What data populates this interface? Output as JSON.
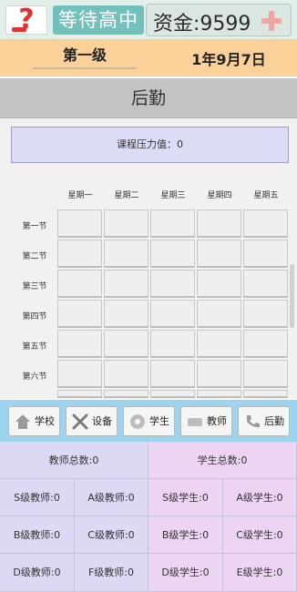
{
  "topbar": {
    "status": "等待高中",
    "funds": "资金:9599",
    "add_icon": "plus-icon",
    "avatar_icon": "question-mark-icon",
    "colors": {
      "status_pill": "#72c1bd",
      "plus": "#f2a3a3",
      "question": "#e03030"
    }
  },
  "infobar": {
    "level": "第一级",
    "date": "1年9月7日"
  },
  "page": {
    "title": "后勤"
  },
  "pressure": {
    "text": "课程压力值：0"
  },
  "schedule": {
    "days": [
      "星期一",
      "星期二",
      "星期三",
      "星期四",
      "星期五"
    ],
    "periods": [
      "第一节",
      "第二节",
      "第三节",
      "第四节",
      "第五节",
      "第六节"
    ]
  },
  "nav": {
    "items": [
      {
        "label": "学校",
        "icon": "house-icon"
      },
      {
        "label": "设备",
        "icon": "tools-icon"
      },
      {
        "label": "学生",
        "icon": "disc-icon"
      },
      {
        "label": "教师",
        "icon": "card-icon"
      },
      {
        "label": "后勤",
        "icon": "phone-icon"
      }
    ]
  },
  "stats": {
    "teacher_total": "教师总数:0",
    "student_total": "学生总数:0",
    "teachers": [
      "S级教师:0",
      "A级教师:0",
      "B级教师:0",
      "C级教师:0",
      "D级教师:0",
      "F级教师:0"
    ],
    "students": [
      "S级学生:0",
      "A级学生:0",
      "B级学生:0",
      "C级学生:0",
      "D级学生:0",
      "E级学生:0"
    ]
  }
}
